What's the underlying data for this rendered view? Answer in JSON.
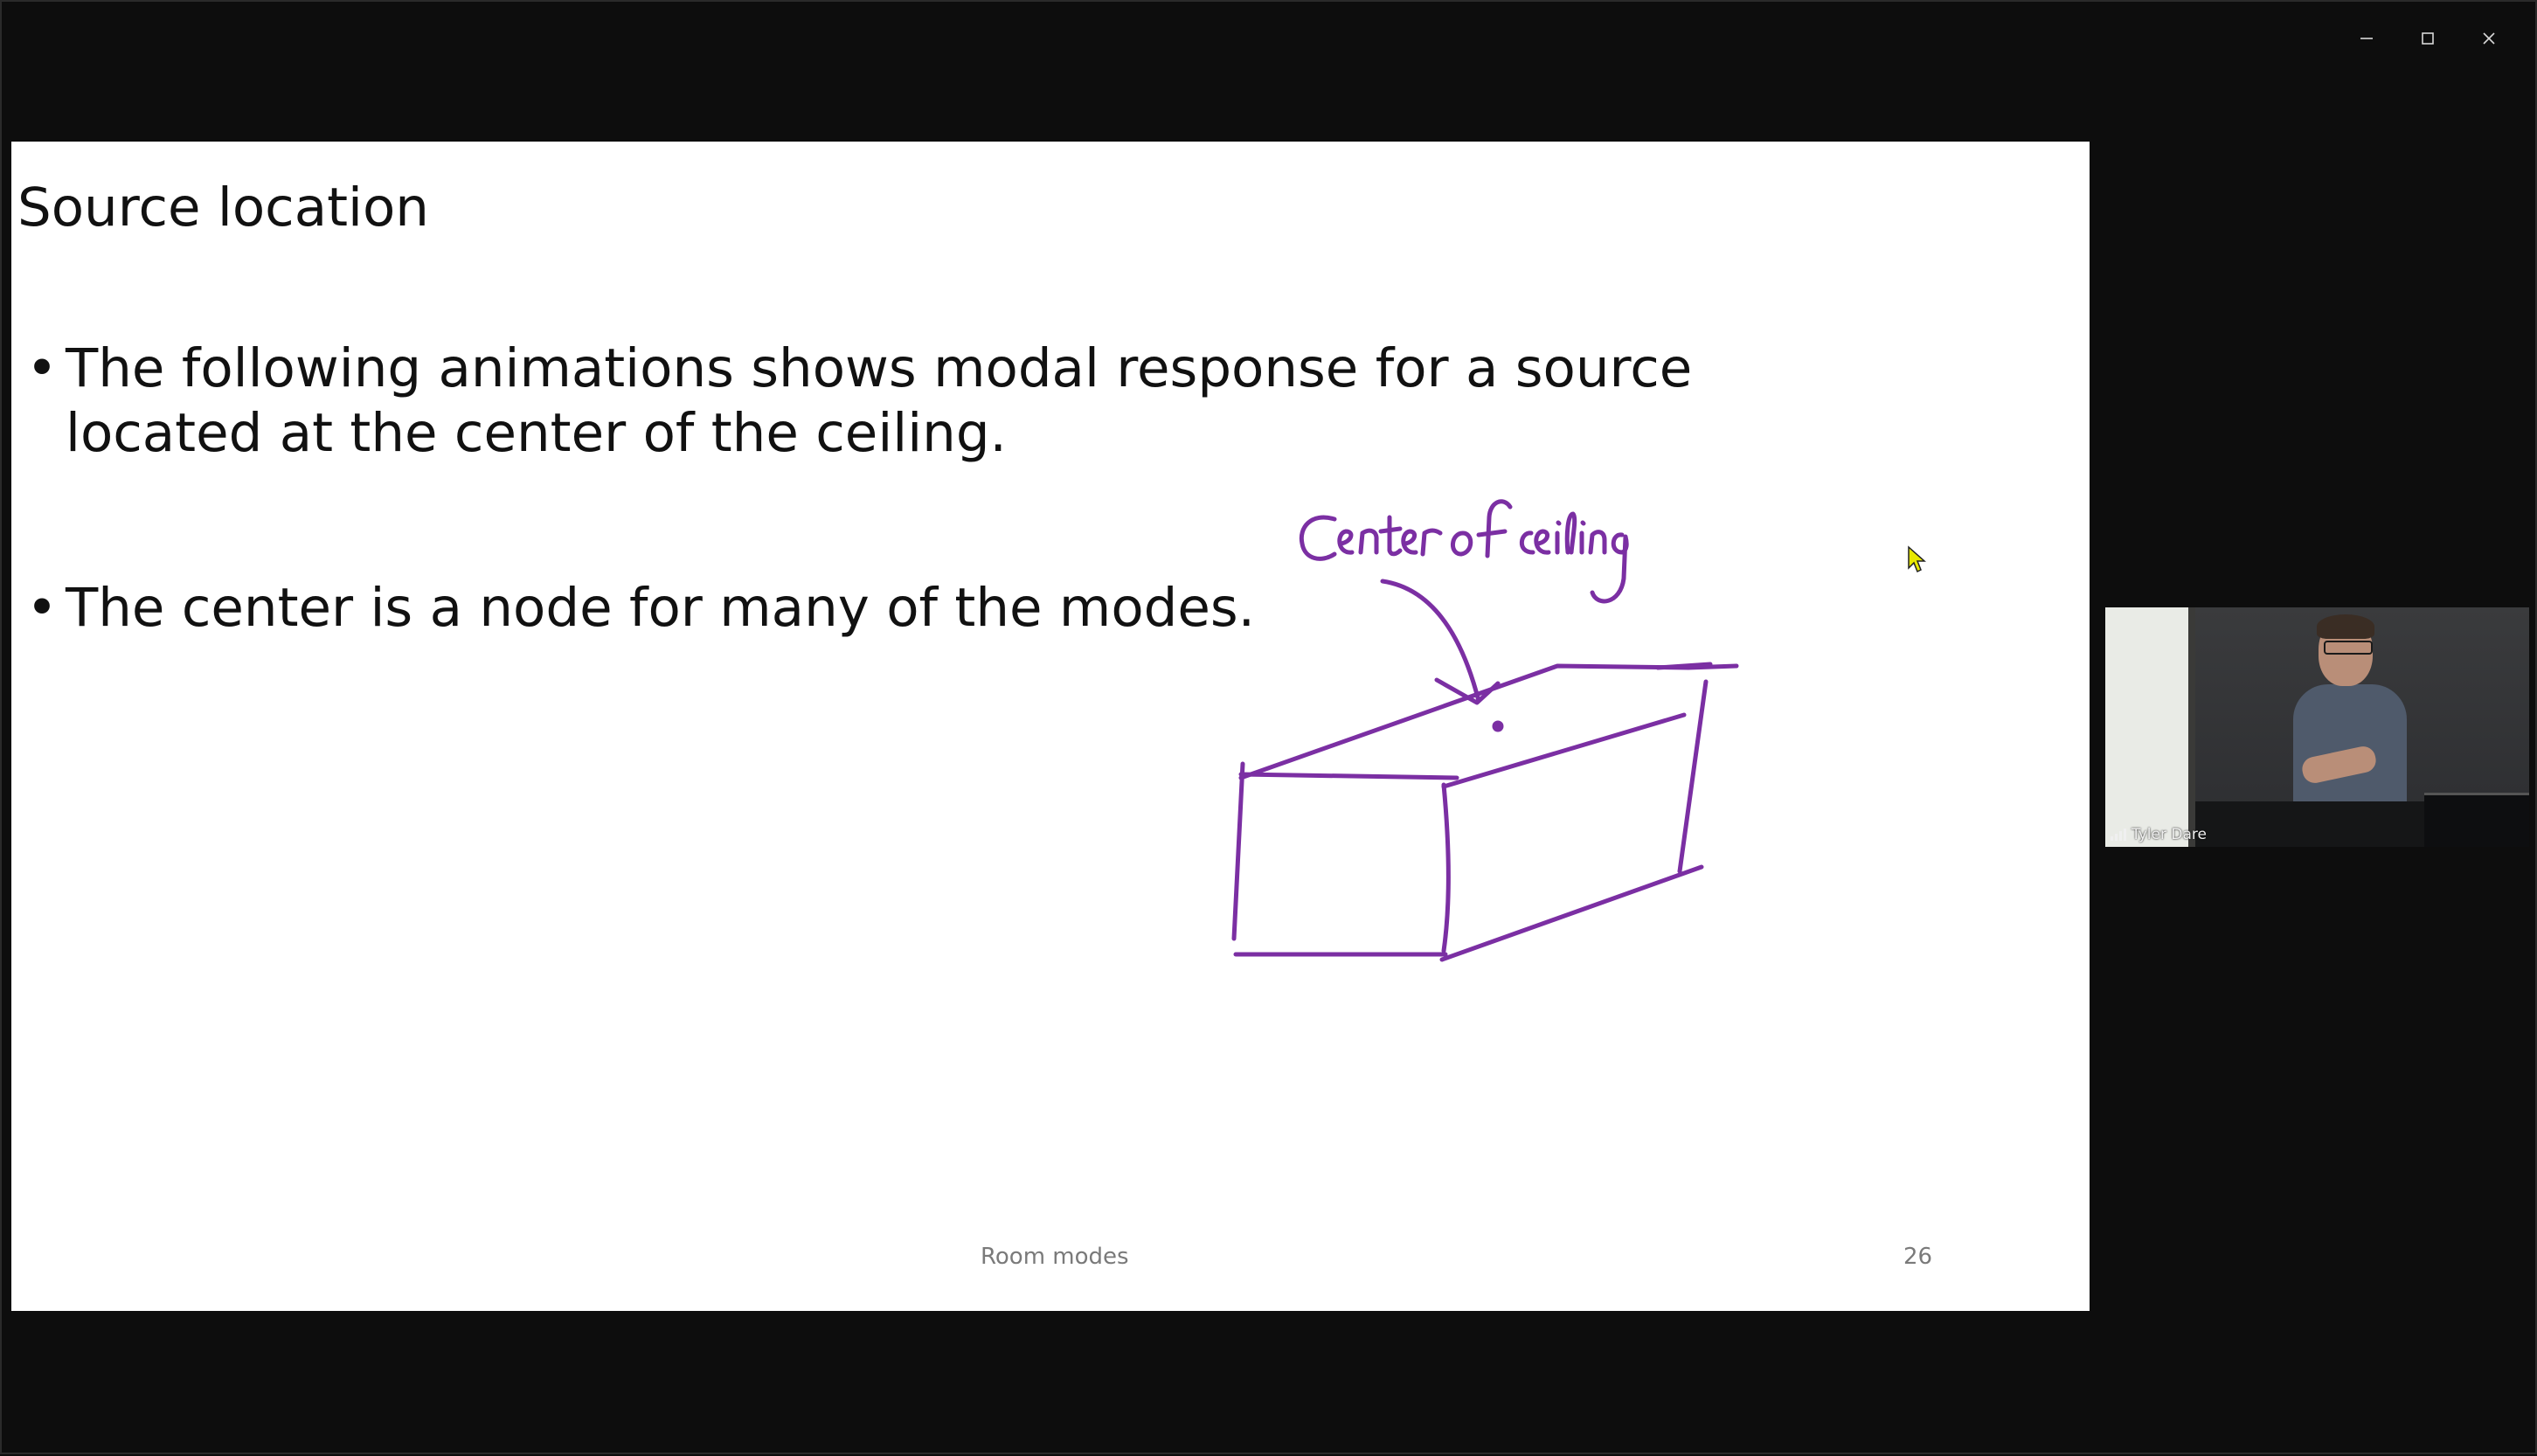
{
  "window": {
    "controls": {
      "minimize_icon": "minimize-icon",
      "maximize_icon": "maximize-icon",
      "close_icon": "close-icon"
    }
  },
  "slide": {
    "title": "Source location",
    "bullets": [
      {
        "marker": "•",
        "text": "The following animations shows modal response for a source located at the center of the ceiling."
      },
      {
        "marker": "•",
        "text": "The center is a node for many of the modes."
      }
    ],
    "annotation": {
      "handwritten_label": "Center of ceiling",
      "ink_color": "#7b2fa3"
    },
    "footer": {
      "title": "Room modes",
      "page_number": "26"
    }
  },
  "video_tile": {
    "participant_name": "Tyler Dare",
    "signal_icon": "signal-strength-icon"
  },
  "colors": {
    "background": "#0d0d0d",
    "slide_background": "#ffffff",
    "ink": "#7b2fa3",
    "cursor": "#e8e800"
  }
}
